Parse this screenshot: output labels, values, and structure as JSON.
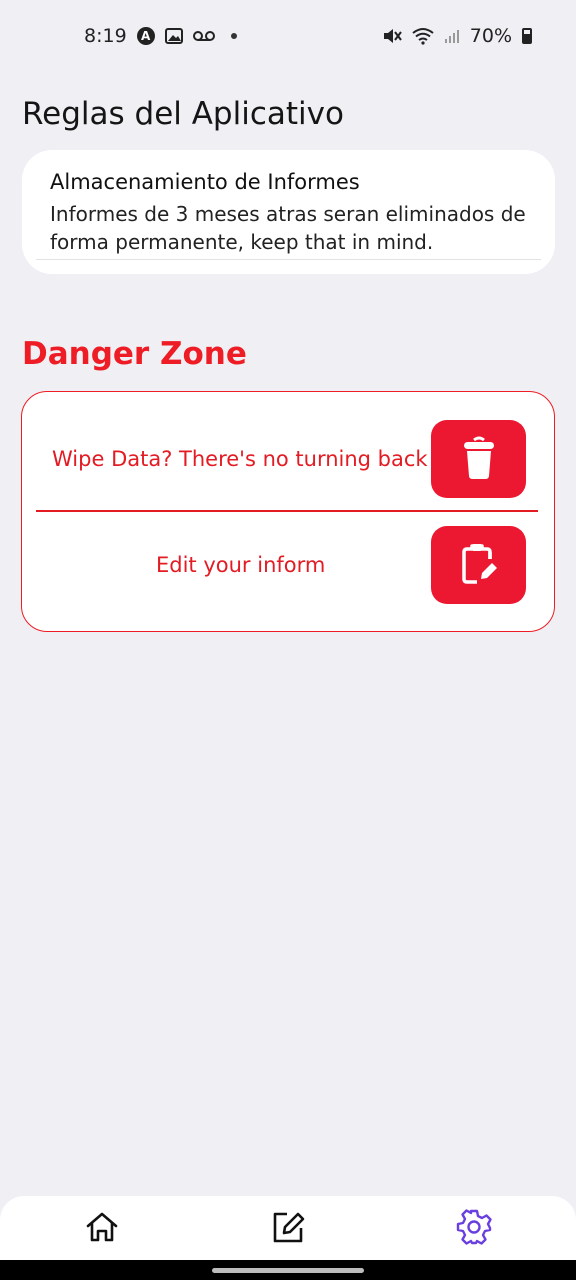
{
  "status_bar": {
    "time": "8:19",
    "battery": "70%",
    "icons": [
      "a-badge-icon",
      "image-icon",
      "voicemail-icon",
      "dot-icon",
      "mute-icon",
      "wifi-icon",
      "signal-icon",
      "battery-icon"
    ]
  },
  "rules_section": {
    "title": "Reglas del Aplicativo",
    "card_title": "Almacenamiento de Informes",
    "card_body": "Informes de 3 meses atras seran eliminados de forma permanente, keep that in mind."
  },
  "danger_section": {
    "title": "Danger Zone",
    "accent_color": "#ee1c24",
    "wipe_label": "Wipe Data? There's no turning back",
    "edit_label": "Edit your inform",
    "wipe_icon": "trash-icon",
    "edit_icon": "clipboard-edit-icon"
  },
  "bottom_nav": {
    "items": [
      {
        "name": "home",
        "icon": "home-icon",
        "active": false
      },
      {
        "name": "edit",
        "icon": "pencil-icon",
        "active": false
      },
      {
        "name": "settings",
        "icon": "gear-icon",
        "active": true
      }
    ],
    "active_color": "#6a3fe0"
  }
}
